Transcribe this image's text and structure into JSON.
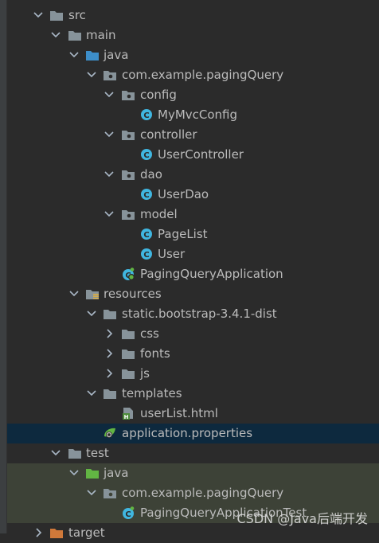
{
  "tree": {
    "items": [
      {
        "label": "src",
        "kind": "folder",
        "expanded": true
      },
      {
        "label": "main",
        "kind": "folder",
        "expanded": true
      },
      {
        "label": "java",
        "kind": "source-folder",
        "expanded": true
      },
      {
        "label": "com.example.pagingQuery",
        "kind": "package",
        "expanded": true
      },
      {
        "label": "config",
        "kind": "package",
        "expanded": true
      },
      {
        "label": "MyMvcConfig",
        "kind": "class"
      },
      {
        "label": "controller",
        "kind": "package",
        "expanded": true
      },
      {
        "label": "UserController",
        "kind": "class"
      },
      {
        "label": "dao",
        "kind": "package",
        "expanded": true
      },
      {
        "label": "UserDao",
        "kind": "class"
      },
      {
        "label": "model",
        "kind": "package",
        "expanded": true
      },
      {
        "label": "PageList",
        "kind": "class"
      },
      {
        "label": "User",
        "kind": "class"
      },
      {
        "label": "PagingQueryApplication",
        "kind": "spring-class"
      },
      {
        "label": "resources",
        "kind": "resource-folder",
        "expanded": true
      },
      {
        "label": "static.bootstrap-3.4.1-dist",
        "kind": "folder",
        "expanded": true
      },
      {
        "label": "css",
        "kind": "folder",
        "expanded": false
      },
      {
        "label": "fonts",
        "kind": "folder",
        "expanded": false
      },
      {
        "label": "js",
        "kind": "folder",
        "expanded": false
      },
      {
        "label": "templates",
        "kind": "folder",
        "expanded": true
      },
      {
        "label": "userList.html",
        "kind": "html-file"
      },
      {
        "label": "application.properties",
        "kind": "properties-file",
        "selected": true
      },
      {
        "label": "test",
        "kind": "folder",
        "expanded": true
      },
      {
        "label": "java",
        "kind": "test-source-folder",
        "expanded": true
      },
      {
        "label": "com.example.pagingQuery",
        "kind": "package",
        "expanded": true
      },
      {
        "label": "PagingQueryApplicationTest",
        "kind": "spring-class"
      },
      {
        "label": "target",
        "kind": "excluded-folder",
        "expanded": false
      }
    ]
  },
  "watermark": "CSDN @Java后端开发",
  "colors": {
    "folder": "#87939a",
    "source_folder": "#3d8ec9",
    "test_folder": "#62b543",
    "class": "#40b6e0",
    "selected_row": "#0d293e",
    "test_row": "#3d4237"
  }
}
